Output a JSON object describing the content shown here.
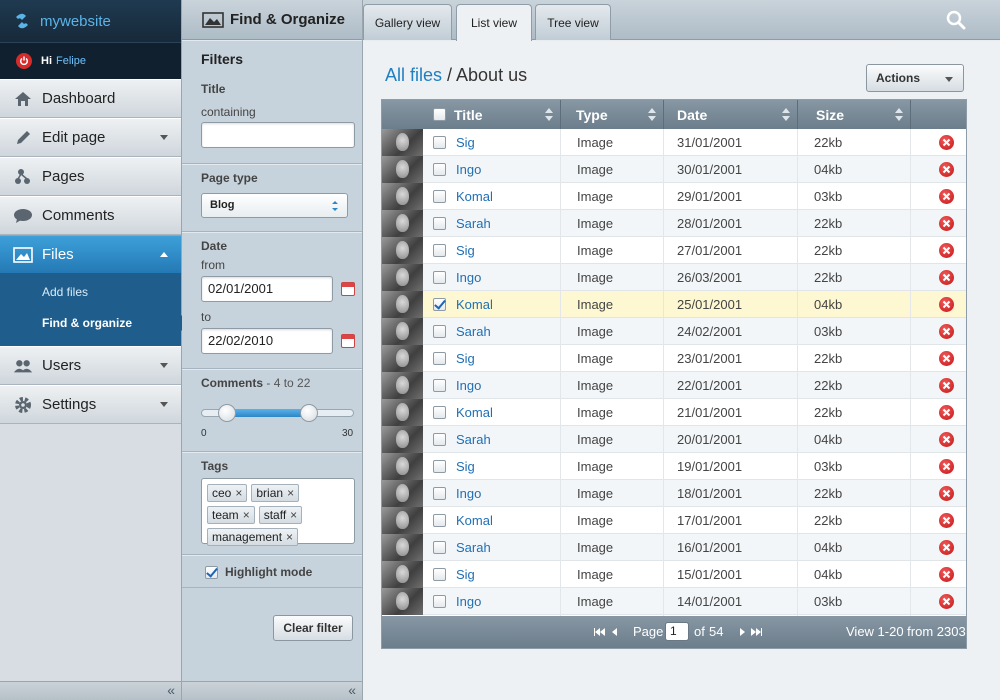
{
  "nav": {
    "brand": "mywebsite",
    "greeting": "Hi",
    "user_name": "Felipe",
    "items": [
      {
        "label": "Dashboard"
      },
      {
        "label": "Edit page"
      },
      {
        "label": "Pages"
      },
      {
        "label": "Comments"
      },
      {
        "label": "Files"
      },
      {
        "label": "Users"
      },
      {
        "label": "Settings"
      }
    ],
    "files_sub": [
      {
        "label": "Add files"
      },
      {
        "label": "Find & organize"
      }
    ],
    "collapse_label": "«"
  },
  "filters": {
    "header": "Find & Organize",
    "title": "Filters",
    "title_label": "Title",
    "containing_label": "containing",
    "containing_value": "",
    "page_type_label": "Page type",
    "page_type_value": "Blog",
    "date_label": "Date",
    "from_label": "from",
    "from_value": "02/01/2001",
    "to_label": "to",
    "to_value": "22/02/2010",
    "comments_label": "Comments",
    "comments_range": "- 4 to 22",
    "slider_min": "0",
    "slider_max": "30",
    "slider_low": 4,
    "slider_high": 22,
    "tags_label": "Tags",
    "tags": [
      "ceo",
      "brian",
      "team",
      "staff",
      "management"
    ],
    "tag_remove": "×",
    "highlight_label": "Highlight mode",
    "highlight_checked": true,
    "clear_button": "Clear filter",
    "collapse_label": "«"
  },
  "tabs": [
    {
      "label": "Gallery view",
      "active": false
    },
    {
      "label": "List view",
      "active": true
    },
    {
      "label": "Tree view",
      "active": false
    }
  ],
  "breadcrumb": {
    "root": "All files",
    "sep": " / ",
    "current": "About us"
  },
  "actions_label": "Actions",
  "grid": {
    "columns": {
      "title": "Title",
      "type": "Type",
      "date": "Date",
      "size": "Size"
    },
    "rows": [
      {
        "title": "Sig",
        "type": "Image",
        "date": "31/01/2001",
        "size": "22kb",
        "checked": false
      },
      {
        "title": "Ingo",
        "type": "Image",
        "date": "30/01/2001",
        "size": "04kb",
        "checked": false
      },
      {
        "title": "Komal",
        "type": "Image",
        "date": "29/01/2001",
        "size": "03kb",
        "checked": false
      },
      {
        "title": "Sarah",
        "type": "Image",
        "date": "28/01/2001",
        "size": "22kb",
        "checked": false
      },
      {
        "title": "Sig",
        "type": "Image",
        "date": "27/01/2001",
        "size": "22kb",
        "checked": false
      },
      {
        "title": "Ingo",
        "type": "Image",
        "date": "26/03/2001",
        "size": "22kb",
        "checked": false
      },
      {
        "title": "Komal",
        "type": "Image",
        "date": "25/01/2001",
        "size": "04kb",
        "checked": true
      },
      {
        "title": "Sarah",
        "type": "Image",
        "date": "24/02/2001",
        "size": "03kb",
        "checked": false
      },
      {
        "title": "Sig",
        "type": "Image",
        "date": "23/01/2001",
        "size": "22kb",
        "checked": false
      },
      {
        "title": "Ingo",
        "type": "Image",
        "date": "22/01/2001",
        "size": "22kb",
        "checked": false
      },
      {
        "title": "Komal",
        "type": "Image",
        "date": "21/01/2001",
        "size": "22kb",
        "checked": false
      },
      {
        "title": "Sarah",
        "type": "Image",
        "date": "20/01/2001",
        "size": "04kb",
        "checked": false
      },
      {
        "title": "Sig",
        "type": "Image",
        "date": "19/01/2001",
        "size": "03kb",
        "checked": false
      },
      {
        "title": "Ingo",
        "type": "Image",
        "date": "18/01/2001",
        "size": "22kb",
        "checked": false
      },
      {
        "title": "Komal",
        "type": "Image",
        "date": "17/01/2001",
        "size": "22kb",
        "checked": false
      },
      {
        "title": "Sarah",
        "type": "Image",
        "date": "16/01/2001",
        "size": "04kb",
        "checked": false
      },
      {
        "title": "Sig",
        "type": "Image",
        "date": "15/01/2001",
        "size": "04kb",
        "checked": false
      },
      {
        "title": "Ingo",
        "type": "Image",
        "date": "14/01/2001",
        "size": "03kb",
        "checked": false
      }
    ],
    "pager": {
      "page_label": "Page",
      "page_value": "1",
      "of_label": "of",
      "total_pages": "54",
      "summary": "View 1-20 from 2303"
    }
  },
  "colors": {
    "accent": "#2a86c8",
    "link": "#1f6fb5",
    "delete": "#d01e1e",
    "highlight_row": "#fdf8d2"
  }
}
